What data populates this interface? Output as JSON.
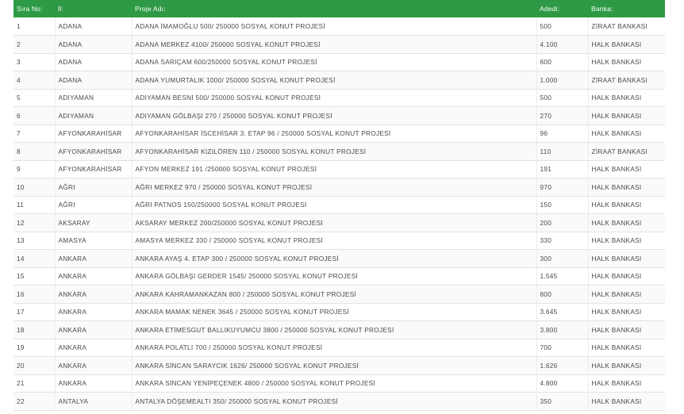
{
  "header": {
    "col_no": "Sıra No:",
    "col_il": "İl:",
    "col_proje": "Proje Adı:",
    "col_adet": "Adedi:",
    "col_banka": "Banka:"
  },
  "colors": {
    "header_bg": "#2e9a45",
    "header_text": "#ffffff",
    "cell_text": "#4a4a4a"
  },
  "rows": [
    {
      "no": "1",
      "il": "ADANA",
      "proje": "ADANA İMAMOĞLU 500/ 250000 SOSYAL KONUT PROJESİ",
      "adet": "500",
      "banka": "ZİRAAT BANKASI"
    },
    {
      "no": "2",
      "il": "ADANA",
      "proje": "ADANA MERKEZ 4100/ 250000 SOSYAL KONUT PROJESİ",
      "adet": "4.100",
      "banka": "HALK BANKASI"
    },
    {
      "no": "3",
      "il": "ADANA",
      "proje": "ADANA SARIÇAM 600/250000 SOSYAL KONUT PROJESİ",
      "adet": "600",
      "banka": "HALK BANKASI"
    },
    {
      "no": "4",
      "il": "ADANA",
      "proje": "ADANA YUMURTALIK 1000/ 250000 SOSYAL KONUT PROJESİ",
      "adet": "1.000",
      "banka": "ZİRAAT BANKASI"
    },
    {
      "no": "5",
      "il": "ADIYAMAN",
      "proje": "ADIYAMAN BESNİ 500/ 250000 SOSYAL KONUT PROJESİ",
      "adet": "500",
      "banka": "HALK BANKASI"
    },
    {
      "no": "6",
      "il": "ADIYAMAN",
      "proje": "ADIYAMAN GÖLBAŞI 270 / 250000 SOSYAL KONUT PROJESİ",
      "adet": "270",
      "banka": "HALK BANKASI"
    },
    {
      "no": "7",
      "il": "AFYONKARAHİSAR",
      "proje": "AFYONKARAHİSAR İSCEHİSAR 3. ETAP 96 / 250000 SOSYAL KONUT PROJESİ",
      "adet": "96",
      "banka": "HALK BANKASI"
    },
    {
      "no": "8",
      "il": "AFYONKARAHİSAR",
      "proje": "AFYONKARAHİSAR KIZILÖREN 110 / 250000 SOSYAL KONUT PROJESİ",
      "adet": "110",
      "banka": "ZİRAAT BANKASI"
    },
    {
      "no": "9",
      "il": "AFYONKARAHİSAR",
      "proje": "AFYON MERKEZ 191 /250000 SOSYAL KONUT PROJESİ",
      "adet": "191",
      "banka": "HALK BANKASI"
    },
    {
      "no": "10",
      "il": "AĞRI",
      "proje": "AĞRI MERKEZ 970 / 250000 SOSYAL KONUT PROJESİ",
      "adet": "970",
      "banka": "HALK BANKASI"
    },
    {
      "no": "11",
      "il": "AĞRI",
      "proje": "AĞRI PATNOS 150/250000 SOSYAL KONUT PROJESİ",
      "adet": "150",
      "banka": "HALK BANKASI"
    },
    {
      "no": "12",
      "il": "AKSARAY",
      "proje": "AKSARAY MERKEZ 200/250000 SOSYAL KONUT PROJESİ",
      "adet": "200",
      "banka": "HALK BANKASI"
    },
    {
      "no": "13",
      "il": "AMASYA",
      "proje": "AMASYA MERKEZ 330 / 250000 SOSYAL KONUT PROJESİ",
      "adet": "330",
      "banka": "HALK BANKASI"
    },
    {
      "no": "14",
      "il": "ANKARA",
      "proje": "ANKARA AYAŞ 4. ETAP 300 / 250000 SOSYAL KONUT PROJESİ",
      "adet": "300",
      "banka": "HALK BANKASI"
    },
    {
      "no": "15",
      "il": "ANKARA",
      "proje": "ANKARA GÖLBAŞI GERDER 1545/ 250000 SOSYAL KONUT PROJESİ",
      "adet": "1.545",
      "banka": "HALK BANKASI"
    },
    {
      "no": "16",
      "il": "ANKARA",
      "proje": "ANKARA KAHRAMANKAZAN 800 / 250000 SOSYAL KONUT PROJESİ",
      "adet": "800",
      "banka": "HALK BANKASI"
    },
    {
      "no": "17",
      "il": "ANKARA",
      "proje": "ANKARA MAMAK NENEK 3645 / 250000 SOSYAL KONUT PROJESİ",
      "adet": "3.645",
      "banka": "HALK BANKASI"
    },
    {
      "no": "18",
      "il": "ANKARA",
      "proje": "ANKARA ETİMESGUT BALLIKUYUMCU 3800 / 250000 SOSYAL KONUT PROJESİ",
      "adet": "3.800",
      "banka": "HALK BANKASI"
    },
    {
      "no": "19",
      "il": "ANKARA",
      "proje": "ANKARA POLATLI 700 / 250000 SOSYAL KONUT PROJESİ",
      "adet": "700",
      "banka": "HALK BANKASI"
    },
    {
      "no": "20",
      "il": "ANKARA",
      "proje": "ANKARA SİNCAN SARAYCIK 1626/ 250000 SOSYAL KONUT PROJESİ",
      "adet": "1.626",
      "banka": "HALK BANKASI"
    },
    {
      "no": "21",
      "il": "ANKARA",
      "proje": "ANKARA SİNCAN YENİPEÇENEK 4800 / 250000 SOSYAL KONUT PROJESİ",
      "adet": "4.800",
      "banka": "HALK BANKASI"
    },
    {
      "no": "22",
      "il": "ANTALYA",
      "proje": "ANTALYA DÖŞEMEALTI 350/ 250000 SOSYAL KONUT PROJESİ",
      "adet": "350",
      "banka": "HALK BANKASI"
    }
  ]
}
